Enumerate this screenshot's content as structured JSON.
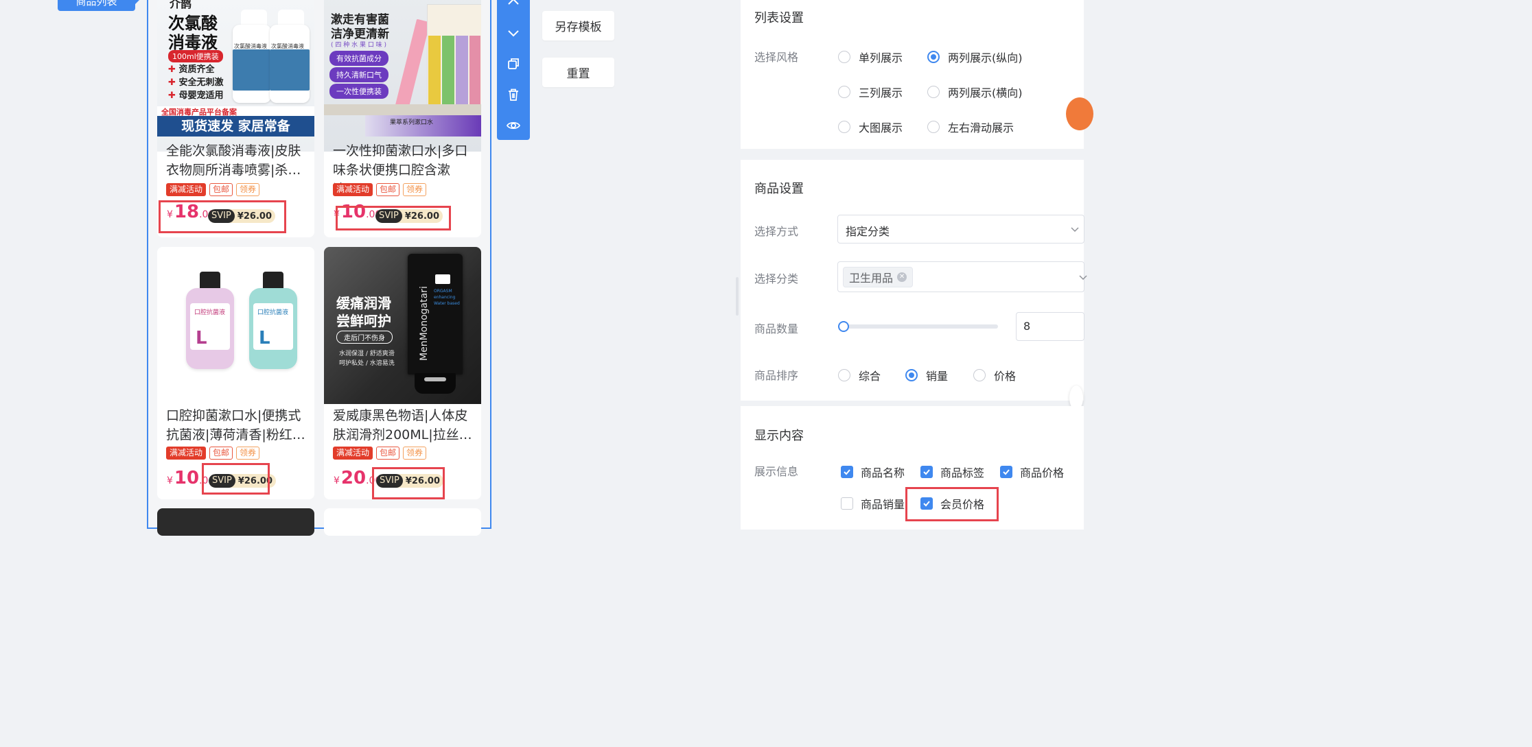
{
  "left_tab": {
    "label": "商品列表"
  },
  "products": [
    {
      "name": "全能次氯酸消毒液|皮肤衣物厕所消毒喷雾|杀…",
      "tags": [
        "满减活动",
        "包邮",
        "领券"
      ],
      "price_yen": "¥",
      "price_int": "18",
      "price_dec": ".00",
      "svip_badge": "SVIP",
      "svip_price": "¥26.00",
      "img": {
        "headline1": "次氯酸",
        "headline2": "消毒液",
        "pill": "100ml便携装",
        "bullets": [
          "资质齐全",
          "安全无刺激",
          "母婴宠适用"
        ],
        "footer_top": "全国消毒产品平台备案",
        "footer": "现货速发  家居常备",
        "top_text": "介鹊",
        "bottle_text": "次氯酸消毒液"
      }
    },
    {
      "name": "一次性抑菌漱口水|多口味条状便携口腔含漱液…",
      "tags": [
        "满减活动",
        "包邮",
        "领券"
      ],
      "price_yen": "¥",
      "price_int": "10",
      "price_dec": ".00",
      "svip_badge": "SVIP",
      "svip_price": "¥26.00",
      "img": {
        "headline1": "漱走有害菌",
        "headline2": "洁净更清新",
        "sub": "( 四 种 水 果 口 味 )",
        "pills": [
          "有效抗菌成分",
          "持久清新口气",
          "一次性便携装"
        ],
        "footer": "果萃系列漱口水"
      }
    },
    {
      "name": "口腔抑菌漱口水|便携式抗菌液|薄荷清香|粉红…",
      "tags": [
        "满减活动",
        "包邮",
        "领券"
      ],
      "price_yen": "¥",
      "price_int": "10",
      "price_dec": ".00",
      "svip_badge": "SVIP",
      "svip_price": "¥26.00",
      "img": {
        "label": "口腔抗菌液"
      }
    },
    {
      "name": "爱威康黑色物语|人体皮肤润滑剂200ML|拉丝…",
      "tags": [
        "满减活动",
        "包邮",
        "领券"
      ],
      "price_yen": "¥",
      "price_int": "20",
      "price_dec": ".00",
      "svip_badge": "SVIP",
      "svip_price": "¥26.00",
      "img": {
        "headline1": "缓痛润滑",
        "headline2": "尝鲜呵护",
        "pill": "走后门不伤身",
        "line1": "水润保湿 / 舒适爽滑",
        "line2": "呵护私处 / 水溶易洗",
        "brand": "MenMonogatari",
        "box_lines": [
          "ORGASM",
          "enhancing",
          "Water based"
        ]
      }
    }
  ],
  "toolbar": {
    "icons": [
      "chevron-up-icon",
      "chevron-down-icon",
      "copy-icon",
      "trash-icon",
      "eye-icon"
    ]
  },
  "actions": {
    "save_template": "另存模板",
    "reset": "重置"
  },
  "list_settings": {
    "title": "列表设置",
    "style_label": "选择风格",
    "styles": [
      "单列展示",
      "两列展示(纵向)",
      "三列展示",
      "两列展示(横向)",
      "大图展示",
      "左右滑动展示"
    ],
    "selected_style": "两列展示(纵向)"
  },
  "goods_settings": {
    "title": "商品设置",
    "method_label": "选择方式",
    "method_value": "指定分类",
    "category_label": "选择分类",
    "category_chip": "卫生用品",
    "count_label": "商品数量",
    "count_value": "8",
    "count_fraction": 0.0,
    "sort_label": "商品排序",
    "sort_options": [
      "综合",
      "销量",
      "价格"
    ],
    "sort_selected": "销量"
  },
  "display_content": {
    "title": "显示内容",
    "info_label": "展示信息",
    "options": [
      {
        "label": "商品名称",
        "checked": true
      },
      {
        "label": "商品标签",
        "checked": true
      },
      {
        "label": "商品价格",
        "checked": true
      },
      {
        "label": "商品销量",
        "checked": false
      },
      {
        "label": "会员价格",
        "checked": true
      }
    ]
  },
  "colors": {
    "accent": "#3f88ef",
    "price": "#e6336b",
    "highlight": "#e6444e",
    "tag_red": "#e23c2a"
  }
}
